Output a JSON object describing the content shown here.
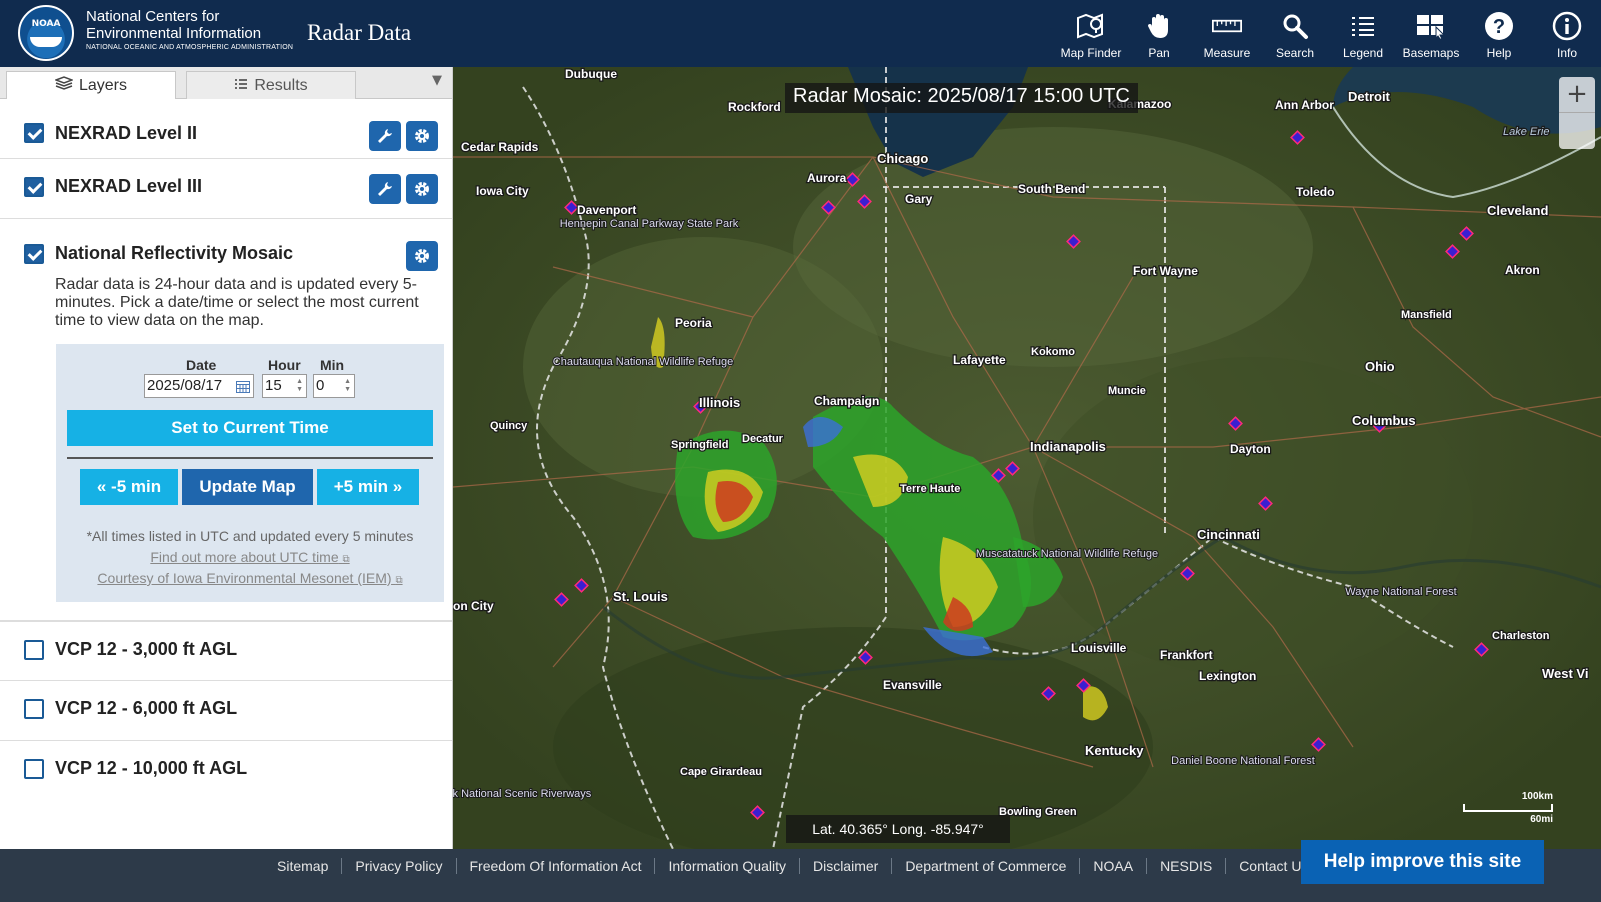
{
  "header": {
    "logo_text": "NOAA",
    "org_line1": "National Centers for",
    "org_line2": "Environmental Information",
    "org_line3": "NATIONAL OCEANIC AND ATMOSPHERIC ADMINISTRATION",
    "app_title": "Radar Data",
    "tools": [
      {
        "label": "Map Finder",
        "icon": "map-finder-icon"
      },
      {
        "label": "Pan",
        "icon": "hand-icon"
      },
      {
        "label": "Measure",
        "icon": "ruler-icon"
      },
      {
        "label": "Search",
        "icon": "search-icon"
      },
      {
        "label": "Legend",
        "icon": "list-icon"
      },
      {
        "label": "Basemaps",
        "icon": "basemaps-icon"
      },
      {
        "label": "Help",
        "icon": "help-icon"
      },
      {
        "label": "Info",
        "icon": "info-icon"
      }
    ]
  },
  "sidebar": {
    "tabs": {
      "layers": "Layers",
      "results": "Results"
    },
    "layers": [
      {
        "name": "NEXRAD Level II",
        "checked": true
      },
      {
        "name": "NEXRAD Level III",
        "checked": true
      },
      {
        "name": "National Reflectivity Mosaic",
        "checked": true
      },
      {
        "name": "VCP 12 - 3,000 ft AGL",
        "checked": false
      },
      {
        "name": "VCP 12 - 6,000 ft AGL",
        "checked": false
      },
      {
        "name": "VCP 12 - 10,000 ft AGL",
        "checked": false
      }
    ],
    "mosaic_description": "Radar data is 24-hour data and is updated every 5-minutes. Pick a date/time or select the most current time to view data on the map.",
    "time_panel": {
      "date_label": "Date",
      "hour_label": "Hour",
      "min_label": "Min",
      "date_value": "2025/08/17",
      "hour_value": "15",
      "min_value": "0",
      "set_current": "Set to Current Time",
      "minus_btn": "« -5 min",
      "update_btn": "Update Map",
      "plus_btn": "+5 min »",
      "note": "*All times listed in UTC and updated every 5 minutes",
      "link_utc": "Find out more about UTC time",
      "link_iem": "Courtesy of Iowa Environmental Mesonet (IEM)"
    }
  },
  "map": {
    "title": "Radar Mosaic: 2025/08/17 15:00 UTC",
    "coords": "Lat. 40.365°  Long. -85.947°",
    "scale_top": "100km",
    "scale_bottom": "60mi",
    "zoom_in": "+",
    "cities": [
      "Dubuque",
      "Rockford",
      "Kalamazoo",
      "Ann Arbor",
      "Detroit",
      "Cedar Rapids",
      "Chicago",
      "Aurora",
      "Iowa City",
      "Davenport",
      "Gary",
      "South Bend",
      "Toledo",
      "Cleveland",
      "Fort Wayne",
      "Akron",
      "Peoria",
      "Mansfield",
      "Lafayette",
      "Kokomo",
      "Ohio",
      "Illinois",
      "Champaign",
      "Muncie",
      "Quincy",
      "Springfield",
      "Decatur",
      "Indianapolis",
      "Columbus",
      "Dayton",
      "Terre Haute",
      "Cincinnati",
      "St. Louis",
      "Louisville",
      "Frankfort",
      "Lexington",
      "Evansville",
      "Charleston",
      "West Vi",
      "Kentucky",
      "Cape Girardeau",
      "Bowling Green",
      "Lake Erie",
      "Hennepin Canal Parkway State Park",
      "Chautauqua National Wildlife Refuge",
      "Muscatatuck National Wildlife Refuge",
      "Wayne National Forest",
      "Daniel Boone National Forest",
      "Ozark National Scenic Riverways",
      "on City"
    ]
  },
  "footer": {
    "links": [
      "Sitemap",
      "Privacy Policy",
      "Freedom Of Information Act",
      "Information Quality",
      "Disclaimer",
      "Department of Commerce",
      "NOAA",
      "NESDIS",
      "Contact Us"
    ],
    "help_improve": "Help improve this site"
  }
}
